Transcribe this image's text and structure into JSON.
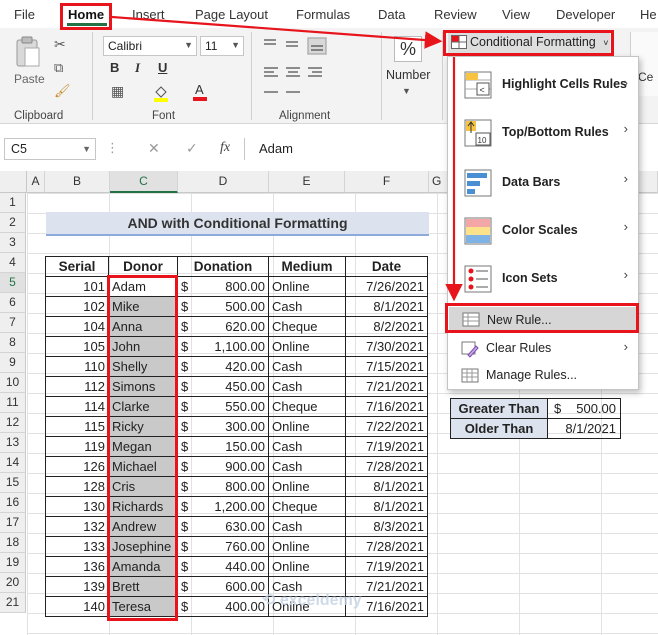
{
  "tabs": [
    "File",
    "Home",
    "Insert",
    "Page Layout",
    "Formulas",
    "Data",
    "Review",
    "View",
    "Developer",
    "He"
  ],
  "ribbon": {
    "paste_label": "Paste",
    "clipboard_label": "Clipboard",
    "font_name": "Calibri",
    "font_size": "11",
    "bold": "B",
    "italic": "I",
    "underline": "U",
    "font_label": "Font",
    "alignment_label": "Alignment",
    "number_label": "Number",
    "number_symbol": "%",
    "cf_button": "Conditional Formatting"
  },
  "formula_bar": {
    "name_box": "C5",
    "fx": "fx",
    "value": "Adam"
  },
  "columns": [
    "A",
    "B",
    "C",
    "D",
    "E",
    "F",
    "G"
  ],
  "rows": [
    "1",
    "2",
    "3",
    "4",
    "5",
    "6",
    "7",
    "8",
    "9",
    "10",
    "11",
    "12",
    "13",
    "14",
    "15",
    "16",
    "17",
    "18",
    "19",
    "20",
    "21"
  ],
  "sheet": {
    "title": "AND with Conditional Formatting",
    "headers": [
      "Serial",
      "Donor",
      "Donation",
      "Medium",
      "Date"
    ],
    "currency": "$",
    "rows": [
      [
        "101",
        "Adam",
        "800.00",
        "Online",
        "7/26/2021"
      ],
      [
        "102",
        "Mike",
        "500.00",
        "Cash",
        "8/1/2021"
      ],
      [
        "104",
        "Anna",
        "620.00",
        "Cheque",
        "8/2/2021"
      ],
      [
        "105",
        "John",
        "1,100.00",
        "Online",
        "7/30/2021"
      ],
      [
        "110",
        "Shelly",
        "420.00",
        "Cash",
        "7/15/2021"
      ],
      [
        "112",
        "Simons",
        "450.00",
        "Cash",
        "7/21/2021"
      ],
      [
        "114",
        "Clarke",
        "550.00",
        "Cheque",
        "7/16/2021"
      ],
      [
        "115",
        "Ricky",
        "300.00",
        "Online",
        "7/22/2021"
      ],
      [
        "119",
        "Megan",
        "150.00",
        "Cash",
        "7/19/2021"
      ],
      [
        "126",
        "Michael",
        "900.00",
        "Cash",
        "7/28/2021"
      ],
      [
        "128",
        "Cris",
        "800.00",
        "Online",
        "8/1/2021"
      ],
      [
        "130",
        "Richards",
        "1,200.00",
        "Cheque",
        "8/1/2021"
      ],
      [
        "132",
        "Andrew",
        "630.00",
        "Cash",
        "8/3/2021"
      ],
      [
        "133",
        "Josephine",
        "760.00",
        "Online",
        "7/28/2021"
      ],
      [
        "136",
        "Amanda",
        "440.00",
        "Online",
        "7/19/2021"
      ],
      [
        "139",
        "Brett",
        "600.00",
        "Cash",
        "7/21/2021"
      ],
      [
        "140",
        "Teresa",
        "400.00",
        "Online",
        "7/16/2021"
      ]
    ],
    "criteria": [
      {
        "label": "Greater Than",
        "prefix": "$",
        "value": "500.00"
      },
      {
        "label": "Older Than",
        "prefix": "",
        "value": "8/1/2021"
      }
    ]
  },
  "menu": {
    "items": [
      {
        "label": "Highlight Cells Rules",
        "submenu": true
      },
      {
        "label": "Top/Bottom Rules",
        "submenu": true
      },
      {
        "label": "Data Bars",
        "submenu": true
      },
      {
        "label": "Color Scales",
        "submenu": true
      },
      {
        "label": "Icon Sets",
        "submenu": true
      },
      {
        "label": "New Rule...",
        "submenu": false
      },
      {
        "label": "Clear Rules",
        "submenu": true
      },
      {
        "label": "Manage Rules...",
        "submenu": false
      }
    ]
  },
  "colors": {
    "excel_green": "#217346",
    "highlight_red": "#e8141c",
    "donor_fill": "#c9c9c9",
    "title_fill": "#dde3ee"
  }
}
